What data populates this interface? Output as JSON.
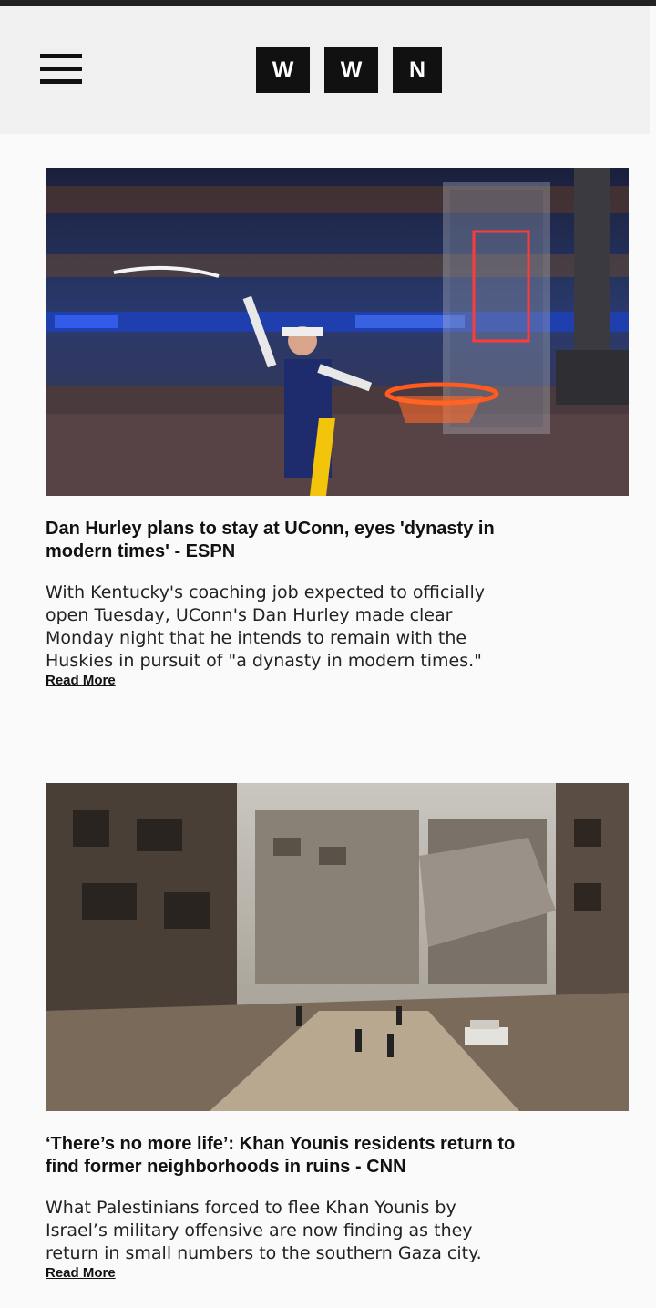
{
  "header": {
    "logo_letters": [
      "W",
      "W",
      "N"
    ]
  },
  "articles": [
    {
      "image_alt": "UConn coach celebrating with net at basketball hoop",
      "title": "Dan Hurley plans to stay at UConn, eyes 'dynasty in modern times' - ESPN",
      "summary": "With Kentucky's coaching job expected to officially open Tuesday, UConn's Dan Hurley made clear Monday night that he intends to remain with the Huskies in pursuit of \"a dynasty in modern times.\"",
      "read_more": "Read More"
    },
    {
      "image_alt": "Destroyed buildings and rubble along a street in Khan Younis",
      "title": "‘There’s no more life’: Khan Younis residents return to find former neighborhoods in ruins - CNN",
      "summary": "What Palestinians forced to flee Khan Younis by Israel’s military offensive are now finding as they return in small numbers to the southern Gaza city.",
      "read_more": "Read More"
    }
  ]
}
